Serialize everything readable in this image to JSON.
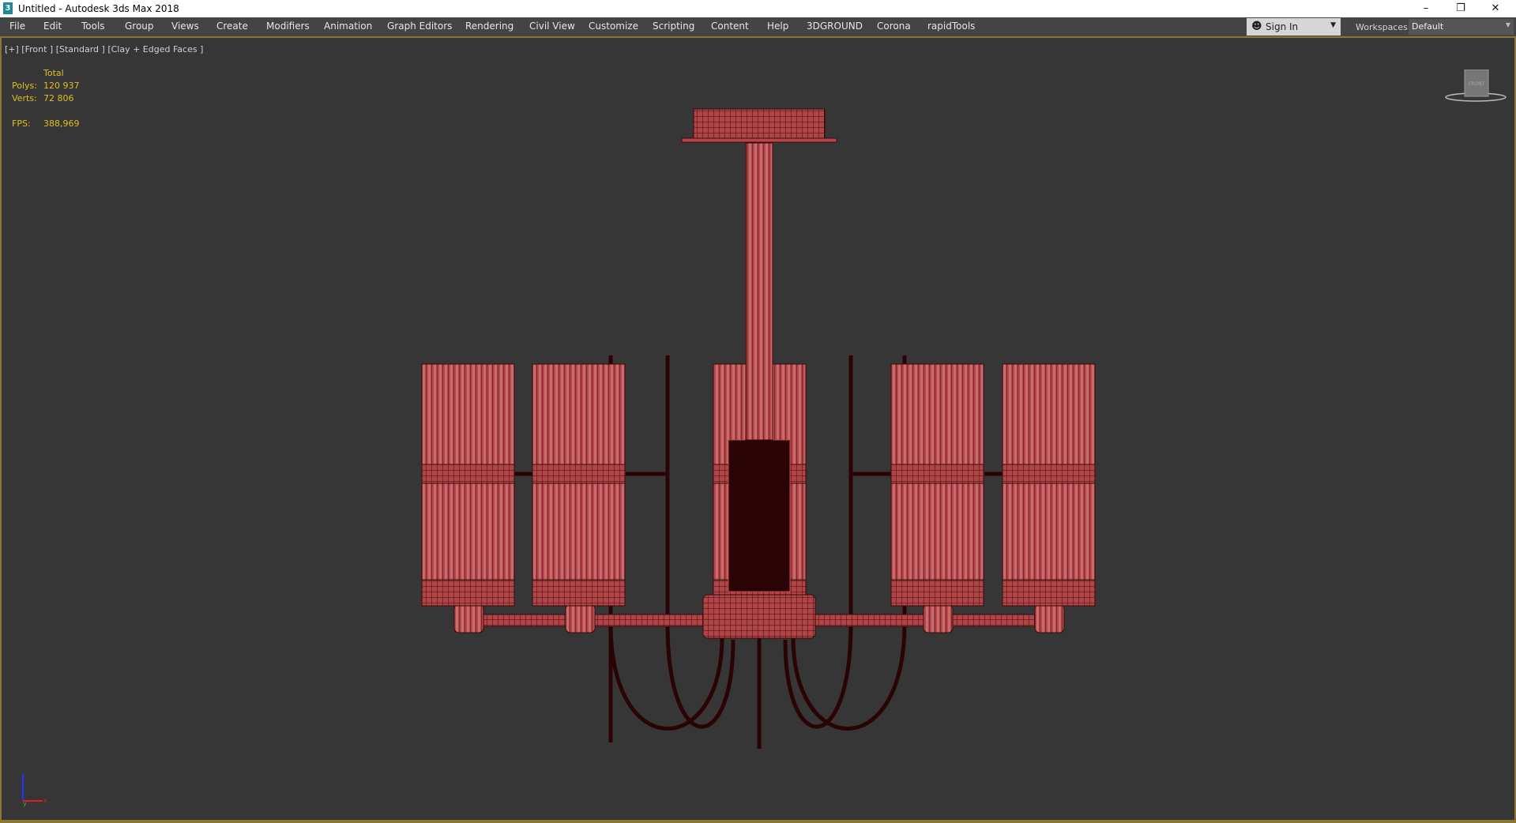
{
  "window": {
    "title": "Untitled - Autodesk 3ds Max 2018",
    "app_icon": "3",
    "controls": [
      "minimize-icon",
      "restore-icon",
      "close-icon"
    ]
  },
  "menu": {
    "items": [
      "File",
      "Edit",
      "Tools",
      "Group",
      "Views",
      "Create",
      "Modifiers",
      "Animation",
      "Graph Editors",
      "Rendering",
      "Civil View",
      "Customize",
      "Scripting",
      "Content",
      "Help",
      "3DGROUND",
      "Corona",
      "rapidTools"
    ]
  },
  "account": {
    "sign_in": "Sign In"
  },
  "workspaces": {
    "label": "Workspaces:",
    "value": "Default"
  },
  "viewport": {
    "label": "[+] [Front ] [Standard ] [Clay + Edged Faces ]",
    "stats": {
      "header": "Total",
      "polys_label": "Polys:",
      "polys": "120 937",
      "verts_label": "Verts:",
      "verts": "72 806",
      "fps_label": "FPS:",
      "fps": "388,969"
    },
    "viewcube": "FRONT",
    "axes": {
      "x": "x",
      "y": "y",
      "z": "z"
    }
  },
  "colors": {
    "model": "#b5474a",
    "wire": "#3a0b0b",
    "dark": "#2a0404",
    "viewport_border": "#8a7532",
    "stats": "#e0c020"
  }
}
